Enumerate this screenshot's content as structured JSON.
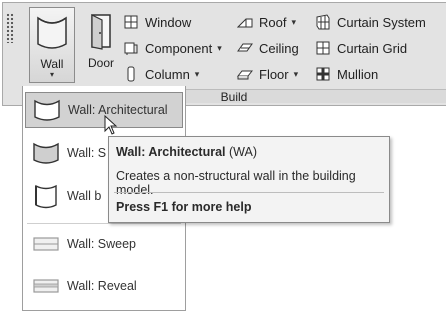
{
  "ribbon": {
    "wall_label": "Wall",
    "door_label": "Door",
    "group_label": "Build",
    "items": {
      "window": "Window",
      "component": "Component",
      "column": "Column",
      "roof": "Roof",
      "ceiling": "Ceiling",
      "floor": "Floor",
      "curtain_system": "Curtain System",
      "curtain_grid": "Curtain Grid",
      "mullion": "Mullion"
    }
  },
  "menu": {
    "items": [
      {
        "label": "Wall: Architectural",
        "icon": "wall-architectural-icon"
      },
      {
        "label": "Wall: S",
        "icon": "wall-structural-icon"
      },
      {
        "label": "Wall b",
        "icon": "wall-by-face-icon"
      },
      {
        "label": "Wall: Sweep",
        "icon": "wall-sweep-icon"
      },
      {
        "label": "Wall: Reveal",
        "icon": "wall-reveal-icon"
      }
    ]
  },
  "tooltip": {
    "title": "Wall: Architectural",
    "title_suffix": " (WA)",
    "description": "Creates a non-structural wall in the building model.",
    "help": "Press F1 for more help"
  }
}
